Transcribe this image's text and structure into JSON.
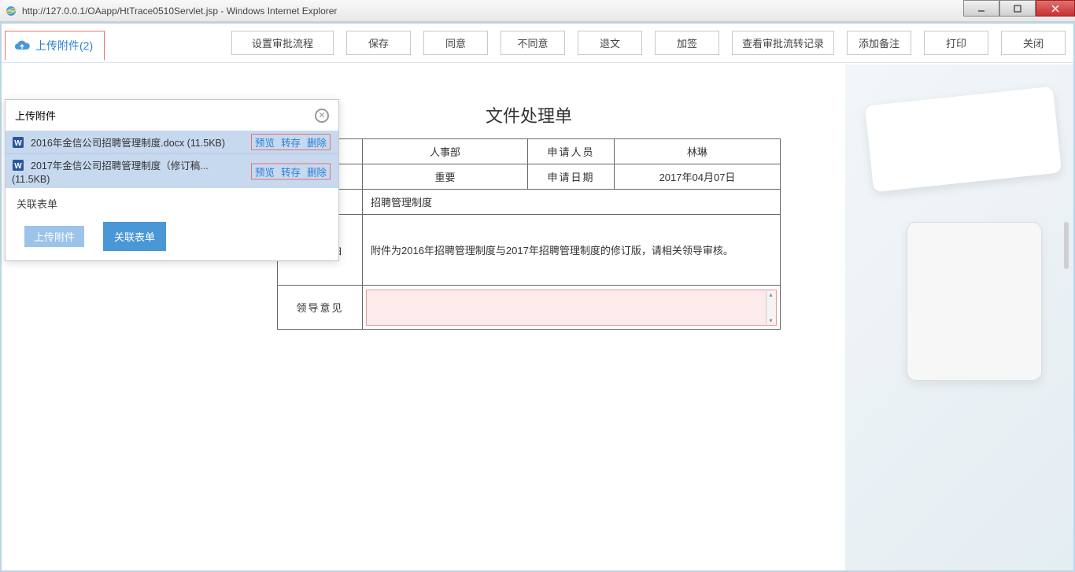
{
  "window": {
    "title": "http://127.0.0.1/OAapp/HtTrace0510Servlet.jsp - Windows Internet Explorer"
  },
  "upload_tab": {
    "label": "上传附件(2)"
  },
  "toolbar": {
    "set_flow": "设置审批流程",
    "save": "保存",
    "agree": "同意",
    "disagree": "不同意",
    "return_doc": "退文",
    "add_sign": "加签",
    "view_flow": "查看审批流转记录",
    "add_remark": "添加备注",
    "print": "打印",
    "close": "关闭"
  },
  "form": {
    "title": "文件处理单",
    "dept_label": "人事部",
    "applicant_label": "申请人员",
    "applicant_value": "林琳",
    "level_label": "重要",
    "date_label": "申请日期",
    "date_value": "2017年04月07日",
    "subject_label": "招聘管理制度",
    "reason_label": "事　　由",
    "reason_value": "附件为2016年招聘管理制度与2017年招聘管理制度的修订版，请相关领导审核。",
    "opinion_label": "领导意见"
  },
  "dropdown": {
    "header": "上传附件",
    "files": [
      {
        "name": "2016年金信公司招聘管理制度.docx (11.5KB)"
      },
      {
        "name": "2017年金信公司招聘管理制度（修订稿...",
        "size": "(11.5KB)"
      }
    ],
    "actions": {
      "preview": "预览",
      "save": "转存",
      "delete": "删除"
    },
    "related_header": "关联表单",
    "upload_btn": "上传附件",
    "relate_btn": "关联表单"
  }
}
